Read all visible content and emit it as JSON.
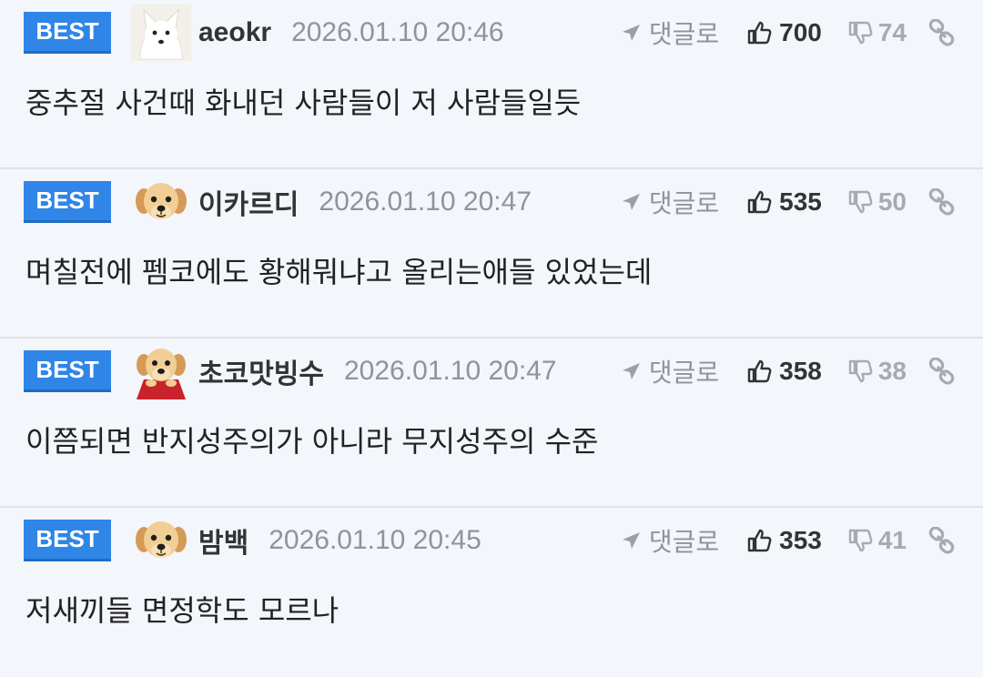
{
  "comments": [
    {
      "badge": "BEST",
      "avatar_icon": "white-fox-avatar-icon",
      "username": "aeokr",
      "timestamp": "2026.01.10 20:46",
      "reply_label": "댓글로",
      "upvotes": "700",
      "downvotes": "74",
      "text": "중추절 사건때 화내던 사람들이 저 사람들일듯"
    },
    {
      "badge": "BEST",
      "avatar_icon": "puppy-avatar-icon",
      "username": "이카르디",
      "timestamp": "2026.01.10 20:47",
      "reply_label": "댓글로",
      "upvotes": "535",
      "downvotes": "50",
      "text": "며칠전에 펨코에도 황해뭐냐고 올리는애들 있었는데"
    },
    {
      "badge": "BEST",
      "avatar_icon": "puppy-red-cape-avatar-icon",
      "username": "초코맛빙수",
      "timestamp": "2026.01.10 20:47",
      "reply_label": "댓글로",
      "upvotes": "358",
      "downvotes": "38",
      "text": "이쯤되면 반지성주의가 아니라 무지성주의 수준"
    },
    {
      "badge": "BEST",
      "avatar_icon": "puppy-avatar-icon",
      "username": "밤백",
      "timestamp": "2026.01.10 20:45",
      "reply_label": "댓글로",
      "upvotes": "353",
      "downvotes": "41",
      "text": "저새끼들 면정학도 모르나"
    }
  ],
  "colors": {
    "badge_blue": "#2f86e7",
    "background": "#f3f6fb",
    "muted_text": "#8f949b"
  }
}
